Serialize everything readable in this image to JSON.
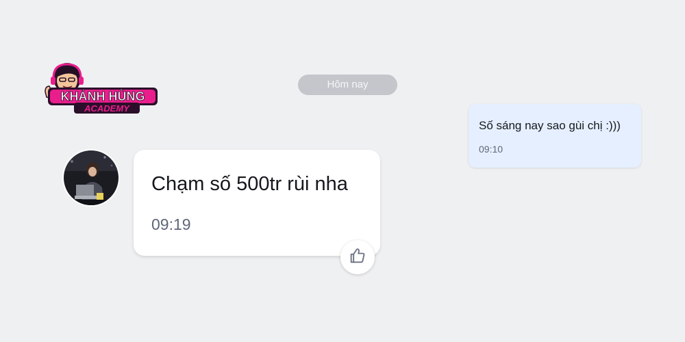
{
  "logo": {
    "line1": "KHÁNH HÙNG",
    "line2": "ACADEMY",
    "colors": {
      "primary": "#e91e8c",
      "accent": "#ffffff",
      "outline": "#2a0f2a"
    }
  },
  "conversation": {
    "date_separator": "Hôm nay",
    "messages": [
      {
        "direction": "outgoing",
        "text": "Số sáng nay sao gùi chị :)))",
        "time": "09:10"
      },
      {
        "direction": "incoming",
        "text": "Chạm số 500tr rùi nha",
        "time": "09:19",
        "reaction_icon": "thumbs-up-icon"
      }
    ]
  },
  "colors": {
    "background": "#eff0f2",
    "outgoing_bubble": "#e5efff",
    "incoming_bubble": "#ffffff",
    "timestamp": "#5f6776",
    "date_pill": "#c4c6cb"
  }
}
